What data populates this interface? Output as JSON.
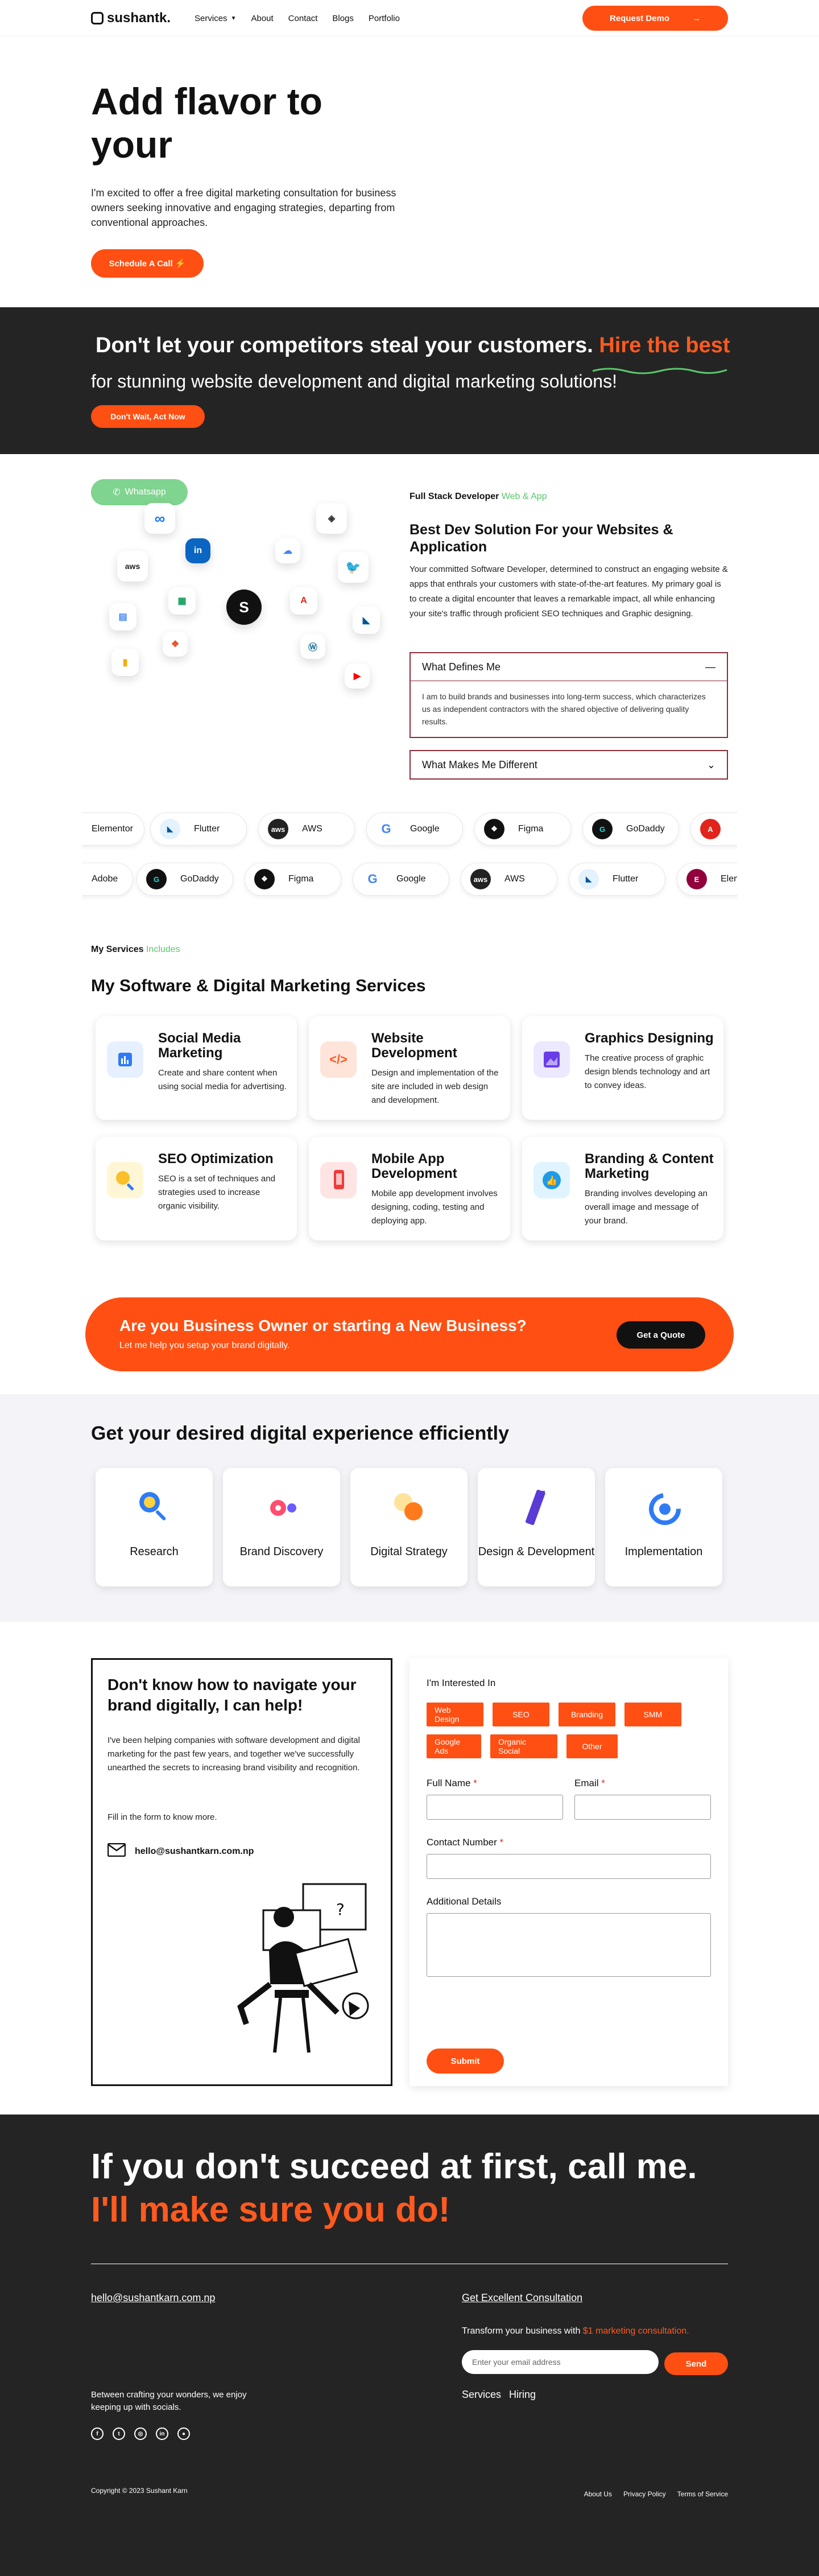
{
  "nav": {
    "logo": "sushantk.",
    "items": [
      "Services",
      "About",
      "Contact",
      "Blogs",
      "Portfolio"
    ],
    "cta": "Request Demo"
  },
  "hero": {
    "title": "Add flavor to your",
    "text": "I'm excited to offer a free digital marketing consultation for business owners seeking innovative and engaging strategies, departing from conventional approaches.",
    "cta": "Schedule A Call ⚡"
  },
  "band": {
    "title_a": "Don't let your competitors steal your customers.",
    "title_b": "Hire the best",
    "subtitle": "for stunning website development and digital marketing solutions!",
    "cta": "Don't Wait, Act Now"
  },
  "dev": {
    "whatsapp": "Whatsapp",
    "eyebrow": "Full Stack Developer",
    "eyebrow_accent": "Web & App",
    "title": "Best Dev Solution For your Websites & Application",
    "desc": "Your committed Software Developer, determined to construct an engaging website & apps that enthrals your customers with state-of-the-art features. My primary goal is to create a digital encounter that leaves a remarkable impact, all while enhancing your site's traffic through proficient SEO techniques and Graphic designing.",
    "acc1_title": "What Defines Me",
    "acc1_body": "I am to build brands and businesses into long-term success, which characterizes us as independent contractors with the shared objective of delivering quality results.",
    "acc2_title": "What Makes Me Different",
    "icons": [
      "aws",
      "Meta",
      "LinkedIn",
      "Google Docs",
      "Google Sheets",
      "Figma",
      "Google Analytics",
      "Squarespace",
      "Google Cloud",
      "Twitter",
      "Adobe",
      "Flutter",
      "WordPress",
      "YouTube",
      "Google Translate"
    ]
  },
  "marquee": {
    "row1": [
      "Elementor",
      "Flutter",
      "AWS",
      "Google",
      "Figma",
      "GoDaddy",
      "Adobe"
    ],
    "row2": [
      "Adobe",
      "GoDaddy",
      "Figma",
      "Google",
      "AWS",
      "Flutter",
      "Elementor"
    ]
  },
  "services": {
    "eyebrow": "My Services",
    "eyebrow_accent": "Includes",
    "title": "My Software & Digital Marketing Services",
    "cards": [
      {
        "title": "Social Media Marketing",
        "text": "Create and share content when using social media for advertising."
      },
      {
        "title": "Website Development",
        "text": "Design and implementation of the site are included in web design and development."
      },
      {
        "title": "Graphics Designing",
        "text": "The creative process of graphic design blends technology and art to convey ideas."
      },
      {
        "title": "SEO Optimization",
        "text": "SEO is a set of techniques and strategies used to increase organic visibility."
      },
      {
        "title": "Mobile App Development",
        "text": "Mobile app development involves designing, coding, testing and deploying app."
      },
      {
        "title": "Branding & Content Marketing",
        "text": "Branding involves developing an overall image and message of your brand."
      }
    ]
  },
  "promo": {
    "title": "Are you Business Owner or starting a New Business?",
    "text": "Let me help you setup your brand digitally.",
    "cta": "Get a Quote"
  },
  "experience": {
    "title": "Get your desired digital experience efficiently",
    "steps": [
      "Research",
      "Brand Discovery",
      "Digital Strategy",
      "Design & Development",
      "Implementation"
    ]
  },
  "contact": {
    "title": "Don't know how to navigate your brand digitally, I can help!",
    "text": "I've been helping companies with software development and digital marketing for the past few years, and together we've successfully unearthed the secrets to increasing brand visibility and recognition.",
    "fill": "Fill in the form to know more.",
    "email": "hello@sushantkarn.com.np",
    "form": {
      "interested": "I'm Interested In",
      "tags": [
        "Web Design",
        "SEO",
        "Branding",
        "SMM",
        "Google Ads",
        "Organic Social",
        "Other"
      ],
      "name": "Full Name",
      "email": "Email",
      "phone": "Contact Number",
      "details": "Additional Details",
      "submit": "Submit",
      "star": "*"
    }
  },
  "footer": {
    "headline_a": "If you don't succeed at first, call me.",
    "headline_b": "I'll make sure you do!",
    "email": "hello@sushantkarn.com.np",
    "consult": "Get Excellent Consultation",
    "transform_a": "Transform your business with",
    "transform_b": "$1 marketing consultation.",
    "email_placeholder": "Enter your email address",
    "send": "Send",
    "links": [
      "Services",
      "Hiring"
    ],
    "blurb": "Between crafting your wonders, we enjoy keeping up with socials.",
    "socials": [
      "facebook-icon",
      "twitter-icon",
      "instagram-icon",
      "linkedin-icon",
      "github-icon"
    ],
    "copyright": "Copyright © 2023 Sushant Karn",
    "bottom_links": [
      "About Us",
      "Privacy Policy",
      "Terms of Service"
    ]
  },
  "colors": {
    "accent": "#ff4f12",
    "dark": "#242424",
    "green": "#5bc66c",
    "maroon": "#8b2c3a"
  }
}
